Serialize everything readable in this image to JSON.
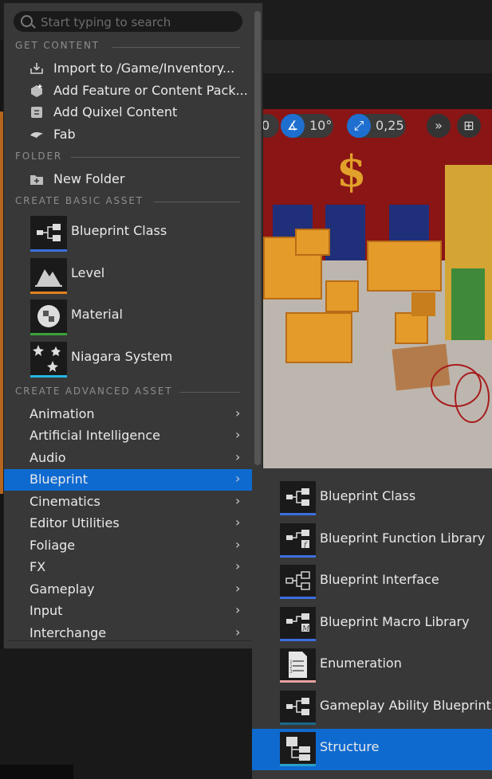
{
  "search": {
    "placeholder": "Start typing to search"
  },
  "viewport_toolbar": {
    "left_partial": "0",
    "rotation_snap": "10°",
    "scale_snap": "0,25"
  },
  "sections": {
    "get_content": "GET CONTENT",
    "folder": "FOLDER",
    "create_basic": "CREATE BASIC ASSET",
    "create_advanced": "CREATE ADVANCED ASSET"
  },
  "get_content_items": [
    {
      "label": "Import to /Game/Inventory...",
      "icon": "import-icon"
    },
    {
      "label": "Add Feature or Content Pack...",
      "icon": "content-pack-icon"
    },
    {
      "label": "Add Quixel Content",
      "icon": "quixel-icon"
    },
    {
      "label": "Fab",
      "icon": "fab-icon"
    }
  ],
  "folder_items": [
    {
      "label": "New Folder",
      "icon": "folder-add-icon"
    }
  ],
  "basic_assets": [
    {
      "label": "Blueprint Class",
      "icon": "blueprint-icon",
      "color": "#3b6fe0"
    },
    {
      "label": "Level",
      "icon": "level-icon",
      "color": "#e5801f"
    },
    {
      "label": "Material",
      "icon": "material-icon",
      "color": "#3aa33a"
    },
    {
      "label": "Niagara System",
      "icon": "niagara-icon",
      "color": "#27b6e6"
    }
  ],
  "advanced_categories": [
    {
      "label": "Animation"
    },
    {
      "label": "Artificial Intelligence"
    },
    {
      "label": "Audio"
    },
    {
      "label": "Blueprint",
      "selected": true
    },
    {
      "label": "Cinematics"
    },
    {
      "label": "Editor Utilities"
    },
    {
      "label": "Foliage"
    },
    {
      "label": "FX"
    },
    {
      "label": "Gameplay"
    },
    {
      "label": "Input"
    },
    {
      "label": "Interchange"
    }
  ],
  "blueprint_submenu": [
    {
      "label": "Blueprint Class",
      "icon": "blueprint-icon",
      "color": "#3b6fe0"
    },
    {
      "label": "Blueprint Function Library",
      "icon": "blueprint-function-icon",
      "color": "#3b6fe0"
    },
    {
      "label": "Blueprint Interface",
      "icon": "blueprint-interface-icon",
      "color": "#3b6fe0"
    },
    {
      "label": "Blueprint Macro Library",
      "icon": "blueprint-macro-icon",
      "color": "#3b6fe0"
    },
    {
      "label": "Enumeration",
      "icon": "enumeration-icon",
      "color": "#e8a0a0"
    },
    {
      "label": "Gameplay Ability Blueprint",
      "icon": "blueprint-icon",
      "color": "#1a6a8a"
    },
    {
      "label": "Structure",
      "icon": "structure-icon",
      "color": "#2aa0c8",
      "selected": true
    }
  ],
  "colors": {
    "accent": "#0f6ad0",
    "menu_bg": "#383838"
  }
}
